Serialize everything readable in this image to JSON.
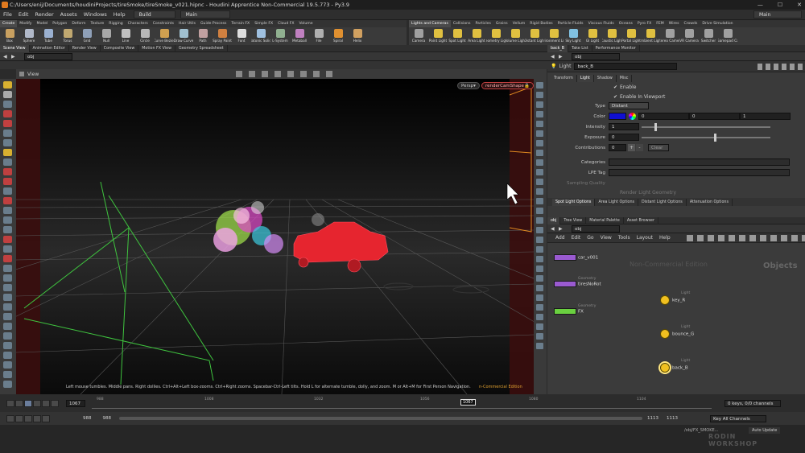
{
  "app": {
    "title": "C:/Users/enij/Documents/houdiniProjects/tireSmoke/tireSmoke_v021.hipnc - Houdini Apprentice Non-Commercial 19.5.773 - Py3.9",
    "menus": [
      "File",
      "Edit",
      "Render",
      "Assets",
      "Windows",
      "Help"
    ],
    "build_label": "Build",
    "desktop_label": "Main",
    "desktop_right": "Main"
  },
  "shelf_left": {
    "tabs": [
      "Create",
      "Modify",
      "Model",
      "Polygon",
      "Deform",
      "Texture",
      "Rigging",
      "Characters",
      "Constraints",
      "Hair Utils",
      "Guide Process",
      "Terrain FX",
      "Simple FX",
      "Cloud FX",
      "Volume"
    ],
    "tools": [
      "Box",
      "Sphere",
      "Tube",
      "Torus",
      "Grid",
      "Null",
      "Line",
      "Circle",
      "Curve Bezier",
      "Draw Curve",
      "Path",
      "Spray Paint",
      "Font",
      "Platonic Solids",
      "L-System",
      "Metaball",
      "File",
      "Spiral",
      "Helix"
    ]
  },
  "shelf_right": {
    "tabs": [
      "Lights and Cameras",
      "Collisions",
      "Particles",
      "Grains",
      "Vellum",
      "Rigid Bodies",
      "Particle Fluids",
      "Viscous Fluids",
      "Oceans",
      "Pyro FX",
      "FEM",
      "Wires",
      "Crowds",
      "Drive Simulation"
    ],
    "tools": [
      "Camera",
      "Point Light",
      "Spot Light",
      "Area Light",
      "Geometry Light",
      "Volume Light",
      "Distant Light",
      "Environment Light",
      "Sky Light",
      "GI Light",
      "Caustic Light",
      "Portal Light",
      "Ambient Light",
      "Stereo Camera",
      "VR Camera",
      "Switcher",
      "Gamepad Ca"
    ]
  },
  "viewer": {
    "tabs": [
      "Scene View",
      "Animation Editor",
      "Render View",
      "Composite View",
      "Motion FX View",
      "Geometry Spreadsheet"
    ],
    "path": "obj",
    "view_label": "View",
    "persp": "Persp",
    "camera": "renderCamShape",
    "hint": "Left mouse tumbles. Middle pans. Right dollies. Ctrl+Alt+Left box-zooms. Ctrl+Right zooms. Spacebar-Ctrl-Left tilts. Hold L for alternate tumble, dolly, and zoom.   M or Alt+M for First Person Navigation.",
    "watermark": "n-Commercial Edition"
  },
  "params": {
    "tabs": [
      "back_B",
      "Take List",
      "Performance Monitor"
    ],
    "path": "obj",
    "node_type": "Light",
    "node_name": "back_B",
    "subtabs": [
      "Transform",
      "Light",
      "Shadow",
      "Misc"
    ],
    "enable": "Enable",
    "enable_viewport": "Enable In Viewport",
    "type_label": "Type",
    "type_value": "Distant",
    "color_label": "Color",
    "color_values": [
      "0",
      "0",
      "1"
    ],
    "color_swatch": "#1010d0",
    "intensity_label": "Intensity",
    "intensity_value": "1",
    "exposure_label": "Exposure",
    "exposure_value": "0",
    "contributions_label": "Contributions",
    "contributions_value": "0",
    "clear_label": "Clear",
    "categories_label": "Categories",
    "lpe_label": "LPE Tag",
    "sampling_label": "Sampling Quality",
    "render_light_geo": "Render Light Geometry",
    "option_tabs": [
      "Spot Light Options",
      "Area Light Options",
      "Distant Light Options",
      "Attenuation Options"
    ]
  },
  "network": {
    "tabs": [
      "obj",
      "Tree View",
      "Material Palette",
      "Asset Browser"
    ],
    "path": "obj",
    "menus": [
      "Add",
      "Edit",
      "Go",
      "View",
      "Tools",
      "Layout",
      "Help"
    ],
    "watermark": "Non-Commercial Edition",
    "context_label": "Objects",
    "nodes": [
      {
        "name": "car_v001",
        "type": "",
        "color": "#9a5ad0"
      },
      {
        "name": "tiresNoRot",
        "type": "Geometry",
        "color": "#9a5ad0"
      },
      {
        "name": "FX",
        "type": "Geometry",
        "color": "#6ad040"
      }
    ],
    "lights": [
      {
        "name": "key_R",
        "type": "Light"
      },
      {
        "name": "bounce_G",
        "type": "Light"
      },
      {
        "name": "back_B",
        "type": "Light"
      }
    ]
  },
  "timeline": {
    "frame": "1067",
    "ticks": [
      "988",
      "1008",
      "1032",
      "1056",
      "1080",
      "1104"
    ],
    "current_marker": "1067",
    "start": "988",
    "start2": "988",
    "end": "1113",
    "end2": "1113",
    "keys_info": "0 keys, 0/0 channels",
    "key_all": "Key All Channels",
    "auto_update": "Auto Update",
    "status_path": "/obj/FX_SMOKE..."
  },
  "brand": {
    "line1": "RODIN",
    "line2": "WORKSHOP"
  }
}
